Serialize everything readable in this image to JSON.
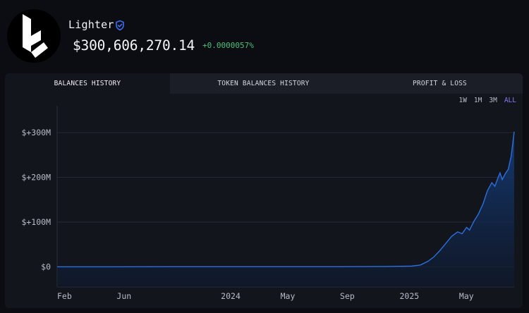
{
  "entity": {
    "name": "Lighter",
    "balance": "$300,606,270.14",
    "change": "+0.0000057%"
  },
  "tabs": [
    {
      "label": "BALANCES HISTORY",
      "active": true
    },
    {
      "label": "TOKEN BALANCES HISTORY",
      "active": false
    },
    {
      "label": "PROFIT & LOSS",
      "active": false
    }
  ],
  "ranges": [
    {
      "label": "1W",
      "active": false
    },
    {
      "label": "1M",
      "active": false
    },
    {
      "label": "3M",
      "active": false
    },
    {
      "label": "ALL",
      "active": true
    }
  ],
  "colors": {
    "line": "#2b6fe0",
    "area_top": "#143d7a",
    "positive": "#4fbf7a",
    "range_active": "#8b7cf6",
    "verified": "#3d6df2"
  },
  "icons": {
    "verified": "verified-badge-icon",
    "logo": "lighter-logo-icon"
  },
  "chart_data": {
    "type": "area",
    "y_ticks": [
      {
        "label": "$+300M",
        "value": 300
      },
      {
        "label": "$+200M",
        "value": 200
      },
      {
        "label": "$+100M",
        "value": 100
      },
      {
        "label": "$0",
        "value": 0
      }
    ],
    "x_ticks": [
      {
        "label": "Feb",
        "month": 0
      },
      {
        "label": "Jun",
        "month": 4
      },
      {
        "label": "2024",
        "month": 11
      },
      {
        "label": "May",
        "month": 15
      },
      {
        "label": "Sep",
        "month": 19
      },
      {
        "label": "2025",
        "month": 23
      },
      {
        "label": "May",
        "month": 27
      }
    ],
    "y_unit": "M USD",
    "ylim": [
      -45,
      360
    ],
    "xlim": [
      0,
      30.7
    ],
    "grid": true,
    "series": [
      {
        "values": [
          [
            0,
            0
          ],
          [
            4,
            0
          ],
          [
            8,
            0.2
          ],
          [
            11,
            0.3
          ],
          [
            15,
            0.2
          ],
          [
            19,
            0.3
          ],
          [
            22,
            0.6
          ],
          [
            23.8,
            1.5
          ],
          [
            24.4,
            4
          ],
          [
            24.9,
            12
          ],
          [
            25.3,
            22
          ],
          [
            25.7,
            36
          ],
          [
            26.1,
            52
          ],
          [
            26.5,
            68
          ],
          [
            26.9,
            78
          ],
          [
            27.2,
            74
          ],
          [
            27.5,
            88
          ],
          [
            27.7,
            82
          ],
          [
            28.0,
            102
          ],
          [
            28.3,
            118
          ],
          [
            28.6,
            140
          ],
          [
            28.9,
            170
          ],
          [
            29.2,
            188
          ],
          [
            29.4,
            180
          ],
          [
            29.6,
            198
          ],
          [
            29.75,
            210
          ],
          [
            29.9,
            195
          ],
          [
            30.1,
            208
          ],
          [
            30.3,
            218
          ],
          [
            30.5,
            248
          ],
          [
            30.7,
            302
          ]
        ]
      }
    ]
  }
}
